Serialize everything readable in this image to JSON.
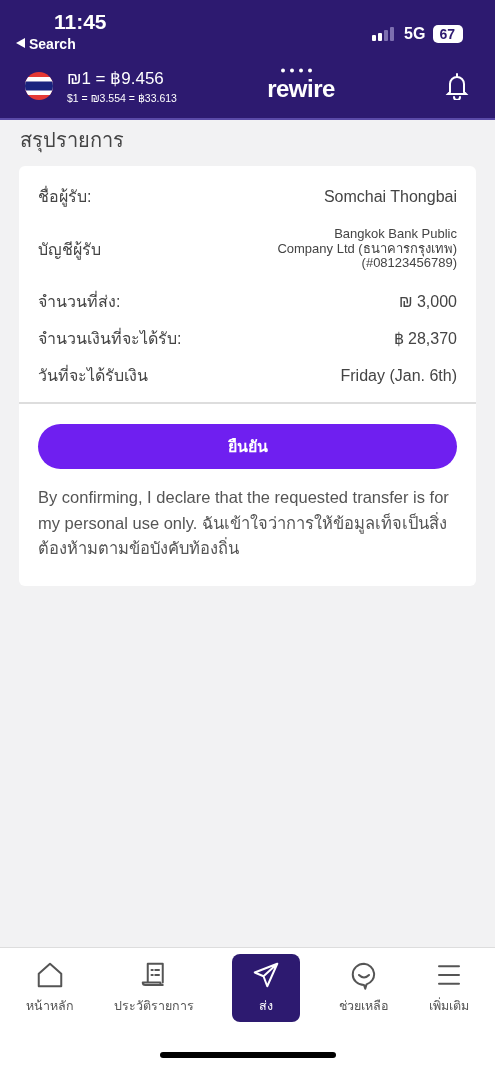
{
  "status_bar": {
    "time": "11:45",
    "back_label": "Search",
    "network": "5G",
    "battery": "67"
  },
  "header": {
    "rate_main": "₪1 = ฿9.456",
    "rate_sub": "$1 = ₪3.554 = ฿33.613",
    "logo": "rewire"
  },
  "summary": {
    "title": "สรุปรายการ",
    "rows": [
      {
        "label": "ชื่อผู้รับ:",
        "value": "Somchai Thongbai",
        "kind": "single"
      },
      {
        "label": "บัญชีผู้รับ",
        "value": [
          "Bangkok Bank Public",
          "Company Ltd (ธนาคารกรุงเทพ)",
          "(#08123456789)"
        ],
        "kind": "multi"
      },
      {
        "label": "จำนวนที่ส่ง:",
        "value": "₪ 3,000",
        "kind": "single"
      },
      {
        "label": "จำนวนเงินที่จะได้รับ:",
        "value": "฿ 28,370",
        "kind": "single"
      },
      {
        "label": "วันที่จะได้รับเงิน",
        "value": "Friday (Jan. 6th)",
        "kind": "single"
      }
    ],
    "confirm_button": "ยืนยัน",
    "disclaimer": "By confirming, I declare that the requested transfer is for my personal use only. ฉันเข้าใจว่าการให้ข้อมูลเท็จเป็นสิ่งต้องห้ามตามข้อบังคับท้องถิ่น"
  },
  "bottom_nav": [
    {
      "label": "หน้าหลัก",
      "kind": "home",
      "selected": false
    },
    {
      "label": "ประวัติรายการ",
      "kind": "history",
      "selected": false
    },
    {
      "label": "ส่ง",
      "kind": "send",
      "selected": true
    },
    {
      "label": "ช่วยเหลือ",
      "kind": "help",
      "selected": false
    },
    {
      "label": "เพิ่มเติม",
      "kind": "more",
      "selected": false
    }
  ]
}
